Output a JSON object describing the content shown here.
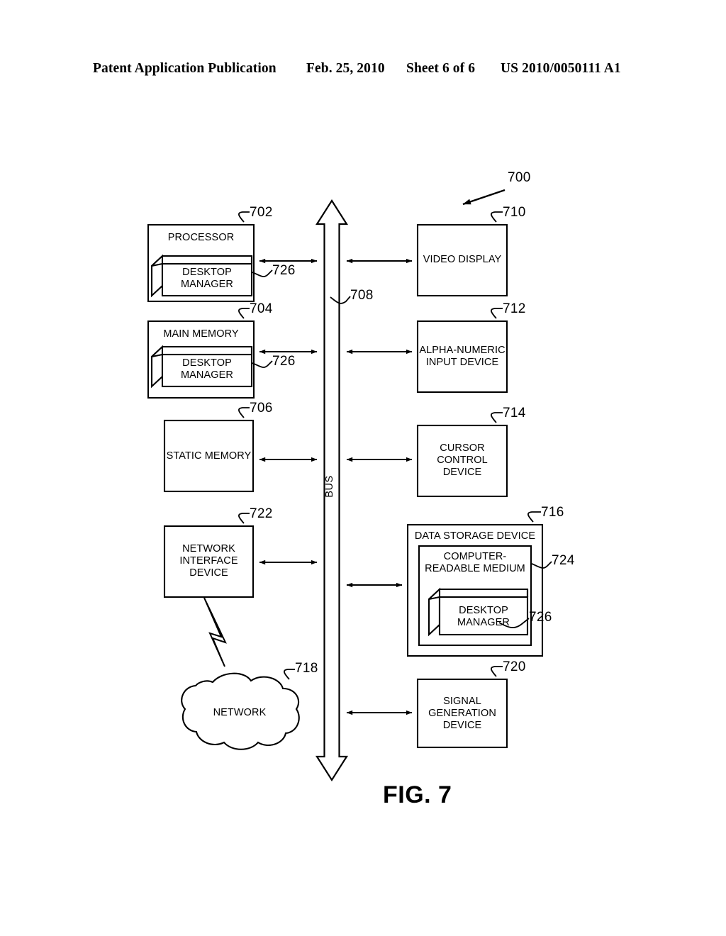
{
  "header": {
    "publication": "Patent Application Publication",
    "date": "Feb. 25, 2010",
    "sheet": "Sheet 6 of 6",
    "patent_number": "US 2010/0050111 A1"
  },
  "figure": {
    "caption": "FIG. 7",
    "system_ref": "700",
    "bus": {
      "label": "BUS",
      "ref": "708"
    },
    "network_cloud": {
      "label": "NETWORK",
      "ref": "718"
    },
    "left_blocks": [
      {
        "id": "processor",
        "title": "PROCESSOR",
        "ref": "702",
        "inner_box": {
          "label": "DESKTOP\nMANAGER",
          "ref": "726"
        }
      },
      {
        "id": "main-memory",
        "title": "MAIN MEMORY",
        "ref": "704",
        "inner_box": {
          "label": "DESKTOP\nMANAGER",
          "ref": "726"
        }
      },
      {
        "id": "static-memory",
        "title": "STATIC MEMORY",
        "ref": "706",
        "inner_box": null
      },
      {
        "id": "network-interface-device",
        "title": "NETWORK\nINTERFACE\nDEVICE",
        "ref": "722",
        "inner_box": null
      }
    ],
    "right_blocks": [
      {
        "id": "video-display",
        "title": "VIDEO DISPLAY",
        "ref": "710"
      },
      {
        "id": "alpha-numeric-input-device",
        "title": "ALPHA-NUMERIC\nINPUT DEVICE",
        "ref": "712"
      },
      {
        "id": "cursor-control-device",
        "title": "CURSOR\nCONTROL\nDEVICE",
        "ref": "714"
      },
      {
        "id": "data-storage-device",
        "title": "DATA STORAGE DEVICE",
        "ref": "716",
        "medium": {
          "label": "COMPUTER-\nREADABLE MEDIUM",
          "ref": "724"
        },
        "inner_box": {
          "label": "DESKTOP\nMANAGER",
          "ref": "726"
        }
      },
      {
        "id": "signal-generation-device",
        "title": "SIGNAL\nGENERATION\nDEVICE",
        "ref": "720"
      }
    ]
  }
}
